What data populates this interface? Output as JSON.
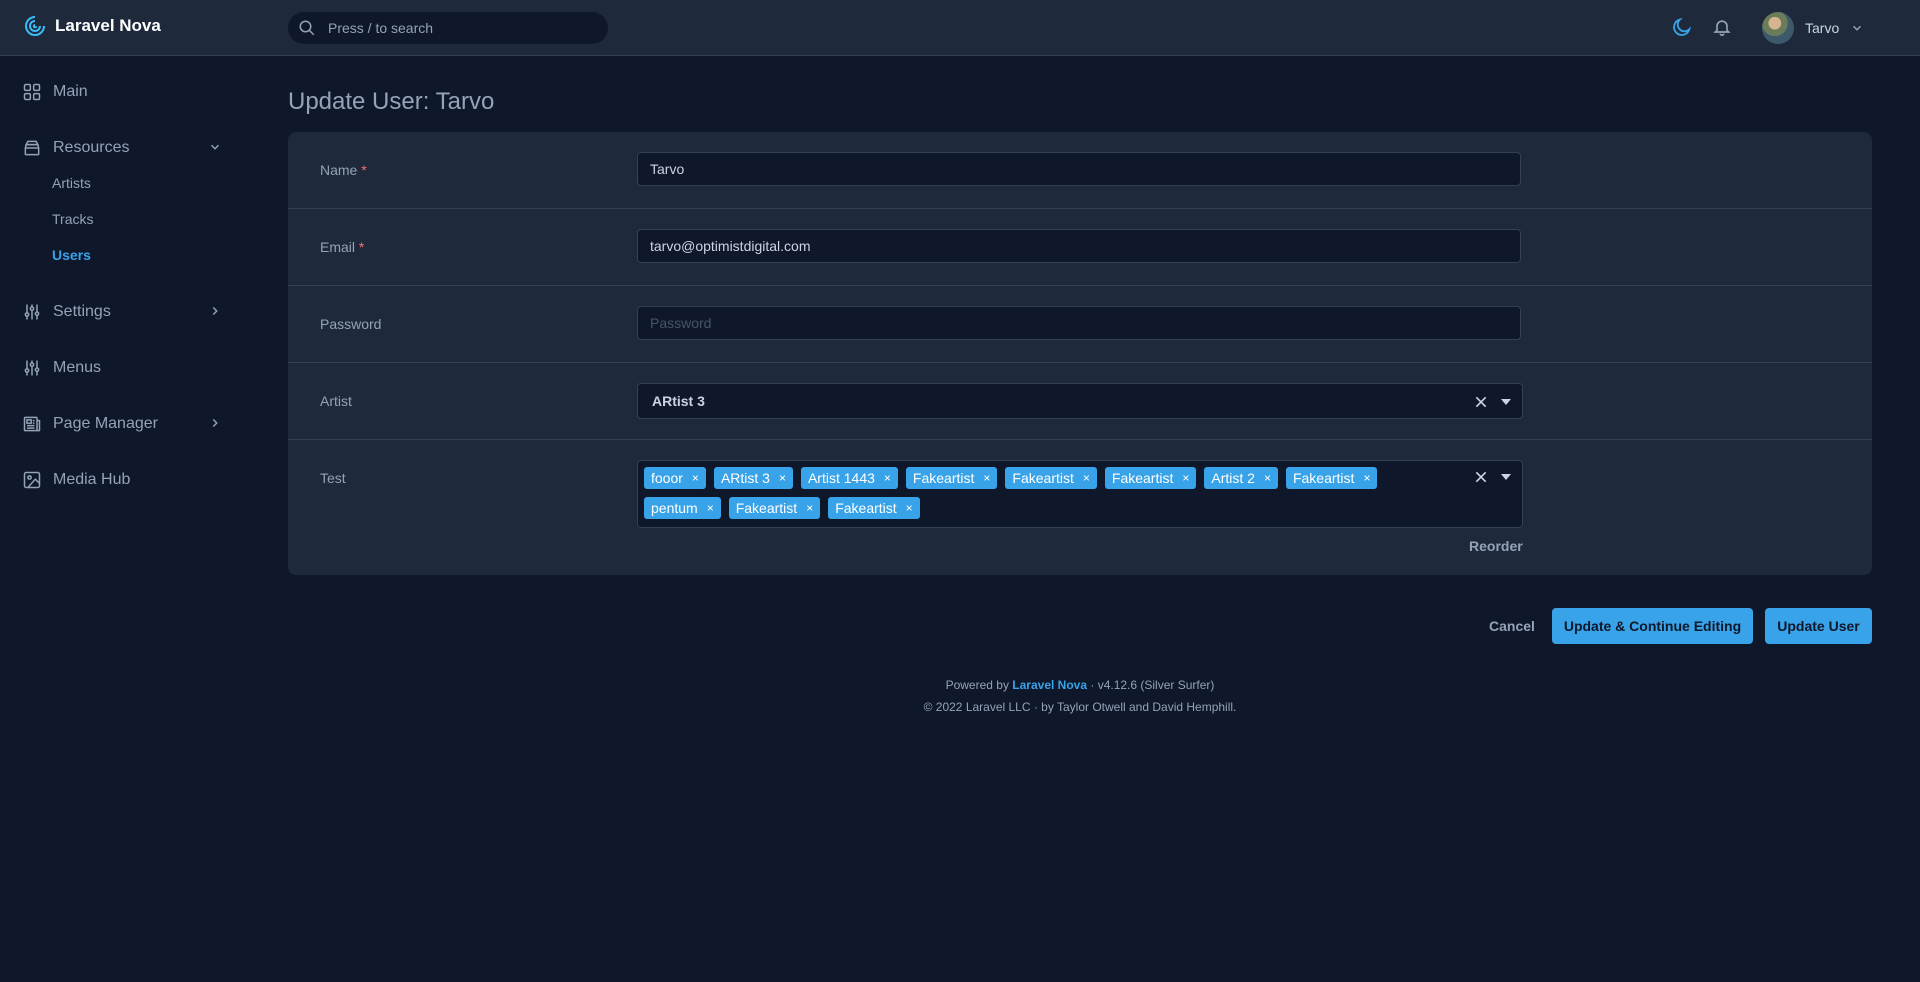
{
  "header": {
    "logo_text": "Laravel Nova",
    "search_placeholder": "Press / to search",
    "user_name": "Tarvo"
  },
  "sidebar": {
    "items": [
      {
        "label": "Main",
        "icon": "grid-icon"
      },
      {
        "label": "Resources",
        "icon": "archive-icon",
        "expanded": true,
        "children": [
          "Artists",
          "Tracks",
          "Users"
        ],
        "active_child": "Users"
      },
      {
        "label": "Settings",
        "icon": "sliders-icon"
      },
      {
        "label": "Menus",
        "icon": "sliders-icon"
      },
      {
        "label": "Page Manager",
        "icon": "newspaper-icon"
      },
      {
        "label": "Media Hub",
        "icon": "image-icon"
      }
    ]
  },
  "page": {
    "title": "Update User: Tarvo"
  },
  "form": {
    "name": {
      "label": "Name",
      "required_mark": "*",
      "value": "Tarvo"
    },
    "email": {
      "label": "Email",
      "required_mark": "*",
      "value": "tarvo@optimistdigital.com"
    },
    "password": {
      "label": "Password",
      "placeholder": "Password",
      "value": ""
    },
    "artist": {
      "label": "Artist",
      "value": "ARtist 3"
    },
    "test": {
      "label": "Test",
      "tags": [
        "fooor",
        "ARtist 3",
        "Artist 1443",
        "Fakeartist",
        "Fakeartist",
        "Fakeartist",
        "Artist 2",
        "Fakeartist",
        "pentum",
        "Fakeartist",
        "Fakeartist"
      ],
      "tag_remove_glyph": "×",
      "reorder_label": "Reorder"
    }
  },
  "actions": {
    "cancel_label": "Cancel",
    "update_continue_label": "Update & Continue Editing",
    "update_label": "Update User"
  },
  "footer": {
    "powered_prefix": "Powered by",
    "brand": "Laravel Nova",
    "version": "· v4.12.6 (Silver Surfer)",
    "copyright": "© 2022 Laravel LLC · by Taylor Otwell and David Hemphill."
  },
  "colors": {
    "background": "#0f172a",
    "panel": "#1e293b",
    "accent": "#38a3e8",
    "required": "#f87171"
  }
}
